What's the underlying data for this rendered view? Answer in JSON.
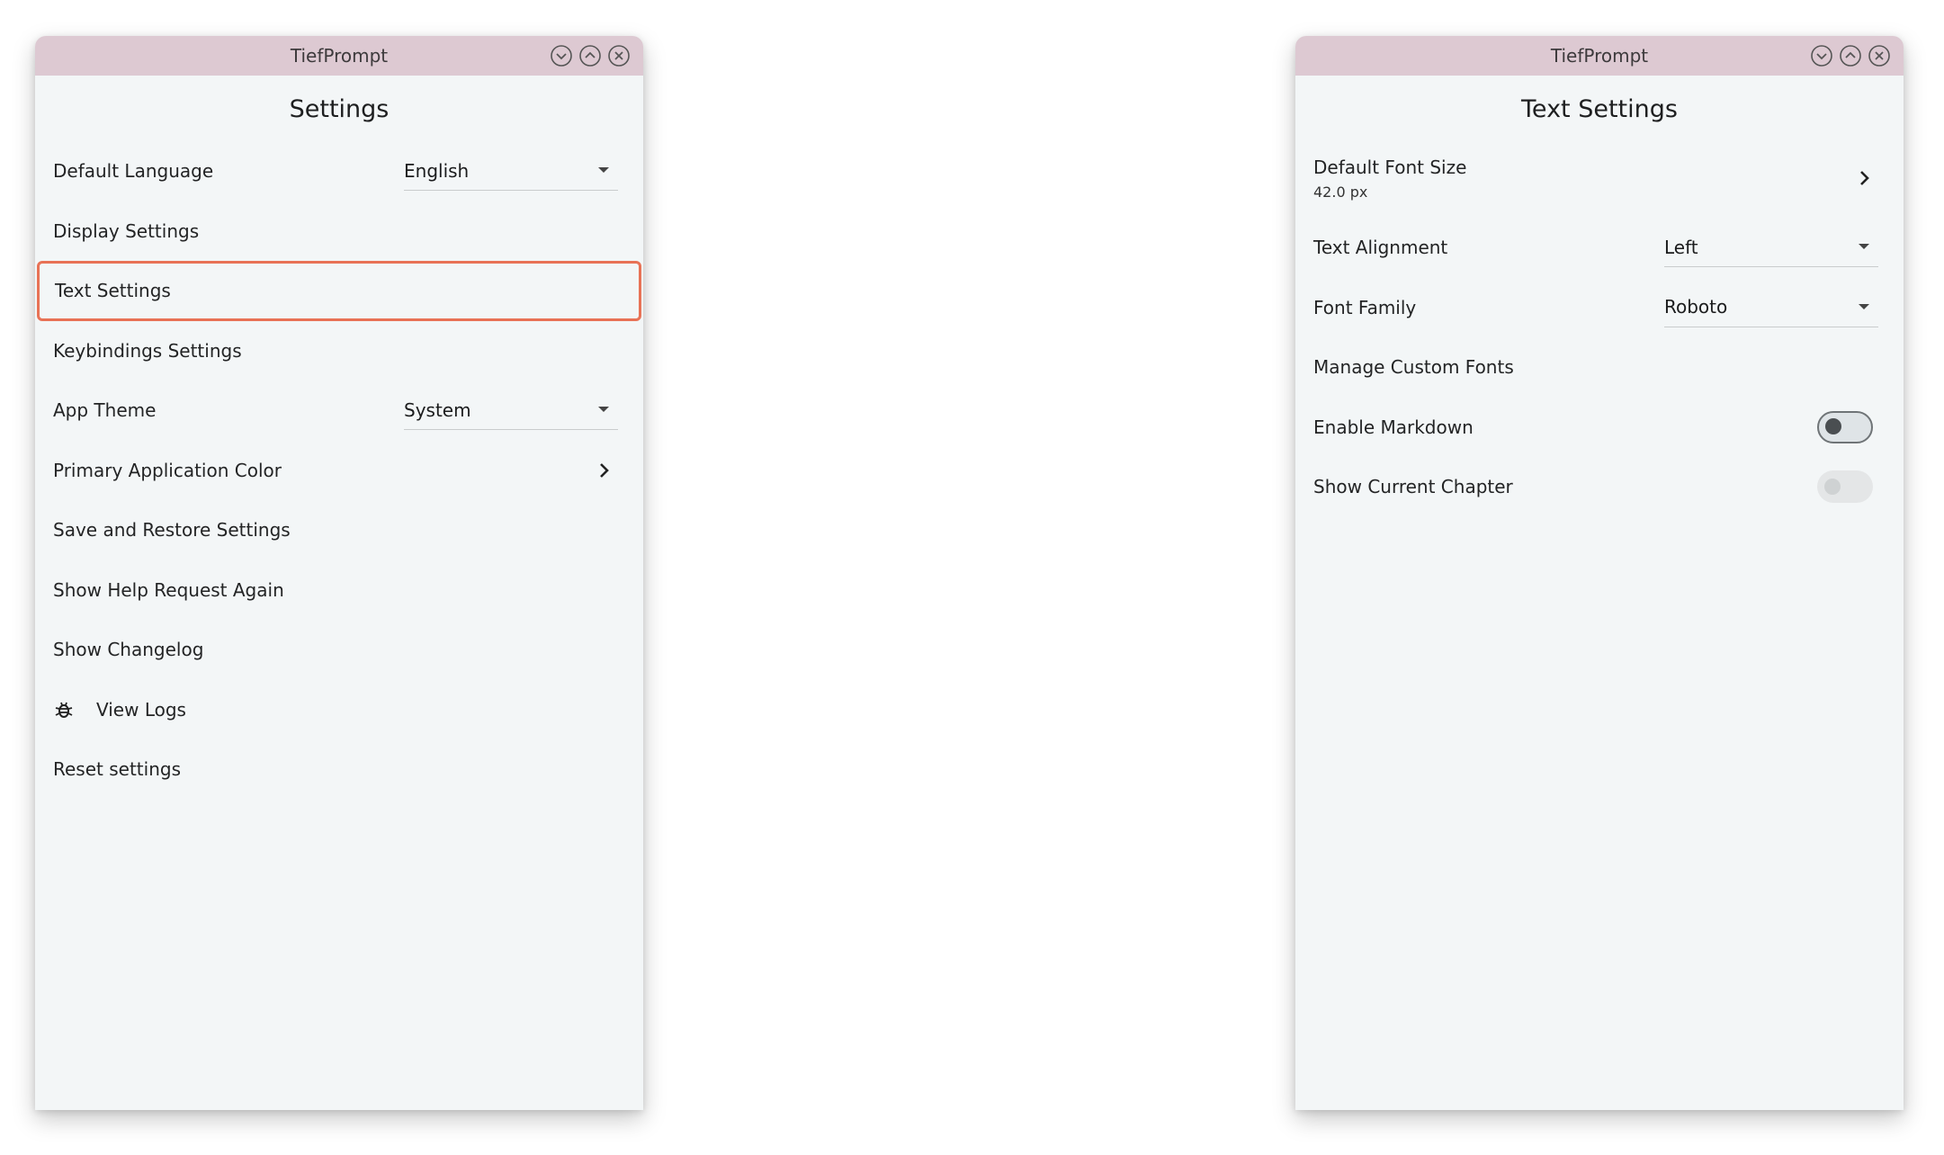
{
  "left_window": {
    "title": "TiefPrompt",
    "heading": "Settings",
    "items": [
      {
        "label": "Default Language",
        "value": "English"
      },
      {
        "label": "Display Settings"
      },
      {
        "label": "Text Settings"
      },
      {
        "label": "Keybindings Settings"
      },
      {
        "label": "App Theme",
        "value": "System"
      },
      {
        "label": "Primary Application Color"
      },
      {
        "label": "Save and Restore Settings"
      },
      {
        "label": "Show Help Request Again"
      },
      {
        "label": "Show Changelog"
      },
      {
        "label": "View Logs",
        "icon": "bug-icon"
      },
      {
        "label": "Reset settings"
      }
    ]
  },
  "right_window": {
    "title": "TiefPrompt",
    "heading": "Text Settings",
    "font_size": {
      "label": "Default Font Size",
      "value": "42.0 px"
    },
    "text_alignment": {
      "label": "Text Alignment",
      "value": "Left"
    },
    "font_family": {
      "label": "Font Family",
      "value": "Roboto"
    },
    "manage_fonts": {
      "label": "Manage Custom Fonts"
    },
    "markdown": {
      "label": "Enable Markdown",
      "state": "off"
    },
    "chapter": {
      "label": "Show Current Chapter",
      "state": "disabled"
    }
  },
  "colors": {
    "titlebar": "#ddc9d2",
    "window_bg": "#f3f6f7",
    "selection_outline": "#e87256"
  }
}
